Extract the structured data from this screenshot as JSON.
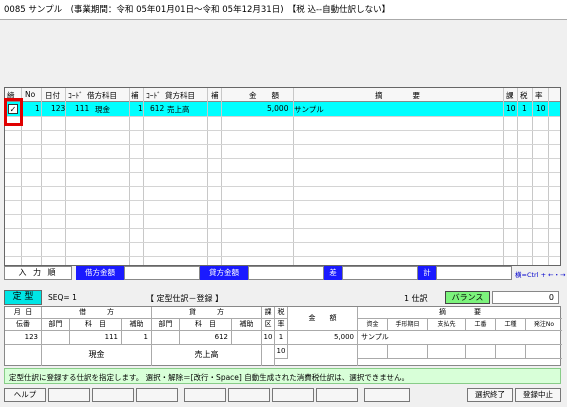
{
  "title": "0085 サンプル　(事業期間：令和 05年01月01日～令和 05年12月31日)　【税 込--自動仕訳しない】",
  "grid": {
    "headers": {
      "check": "締",
      "no": "No",
      "date": "日付",
      "dcode": "ｺｰﾄﾞ",
      "dacct": "借方科目",
      "dsub": "補",
      "ccode": "ｺｰﾄﾞ",
      "cacct": "貸方科目",
      "csub": "補",
      "amount": "金　　額",
      "memo": "摘　　　　要",
      "kazei": "課",
      "zei": "税",
      "rate": "率"
    },
    "row": {
      "checked": "✓",
      "no": "1",
      "date": "123",
      "dcode": "111",
      "dacct": "現金",
      "dsub": "1",
      "ccode": "612",
      "cacct": "売上高",
      "amount": "5,000",
      "memo": "サンプル",
      "kazei": "10",
      "zei": "1",
      "rate": "10"
    }
  },
  "summary": {
    "input_order": "入 力 順",
    "debit_total": "借方金額",
    "credit_total": "貸方金額",
    "diff": "差",
    "total": "計",
    "shortcut": "横=Ctrl + ←・→"
  },
  "template": {
    "tab": "定 型",
    "seq": "SEQ= 1",
    "mode": "【 定型仕訳－登録 】",
    "count": "1 仕訳",
    "balance": "バランス",
    "balance_value": "0",
    "headers": {
      "month": "月",
      "day": "日",
      "debit": "借　　　方",
      "credit": "貸　　　方",
      "kazei": "課",
      "zei": "税",
      "memo": "摘　　　　要",
      "denban": "伝番",
      "dept": "部門",
      "acct": "科　目",
      "sub": "補助",
      "dept2": "部門",
      "acct2": "科　目",
      "sub2": "補助",
      "kubun": "区",
      "rate": "率",
      "amount": "金　　額",
      "shikin": "資金",
      "tegata": "手形期日",
      "shiharai": "支払先",
      "koji": "工番",
      "koshu": "工種",
      "hatchu": "発注No"
    },
    "row": {
      "date": "123",
      "dacct": "111",
      "dsub": "1",
      "cacct": "612",
      "kazei": "10",
      "kubun": "1",
      "amount": "5,000",
      "memo": "サンプル",
      "dacct_name": "現金",
      "cacct_name": "売上高",
      "rate2": "10"
    }
  },
  "message": "定型仕訳に登録する仕訳を指定します。 選択・解除＝[改行・Space] 自動生成された消費税仕訳は、選択できません。",
  "fkeys": [
    "ヘルプ",
    "",
    "",
    "",
    "",
    "",
    "",
    "",
    "",
    "選択終了",
    "登録中止"
  ],
  "colors": {
    "selected_row": "#00ffff",
    "accent_blue": "#1a1aff",
    "balance_green": "#7cf37c"
  }
}
